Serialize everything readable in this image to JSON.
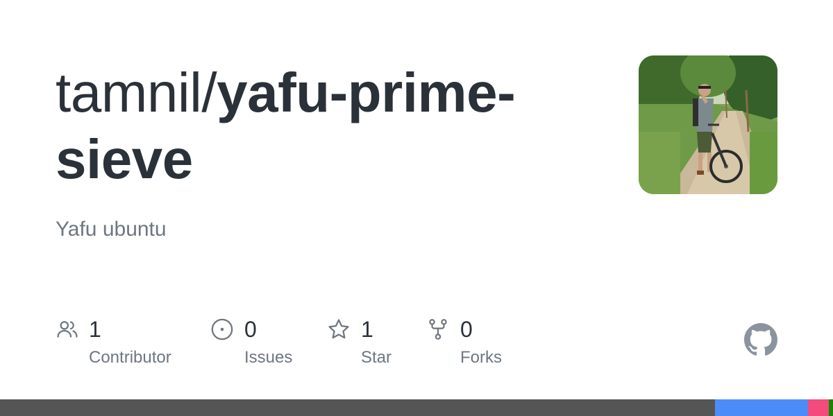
{
  "repo": {
    "owner_prefix": "tamnil/",
    "name_line1": "yafu-prime-",
    "name_line2": "sieve",
    "description": "Yafu ubuntu"
  },
  "stats": {
    "contributors": {
      "count": "1",
      "label": "Contributor",
      "icon": "people-icon"
    },
    "issues": {
      "count": "0",
      "label": "Issues",
      "icon": "issue-opened-icon"
    },
    "stars": {
      "count": "1",
      "label": "Star",
      "icon": "star-icon"
    },
    "forks": {
      "count": "0",
      "label": "Forks",
      "icon": "repo-forked-icon"
    }
  },
  "colors": {
    "title": "#2b3139",
    "muted": "#6e7681",
    "icon": "#6e7681",
    "github_mark": "#8b949e"
  },
  "language_bar": [
    {
      "color": "#555555",
      "fraction": 0.858
    },
    {
      "color": "#4c8cf8",
      "fraction": 0.112
    },
    {
      "color": "#f34b7d",
      "fraction": 0.025
    },
    {
      "color": "#178600",
      "fraction": 0.005
    }
  ]
}
